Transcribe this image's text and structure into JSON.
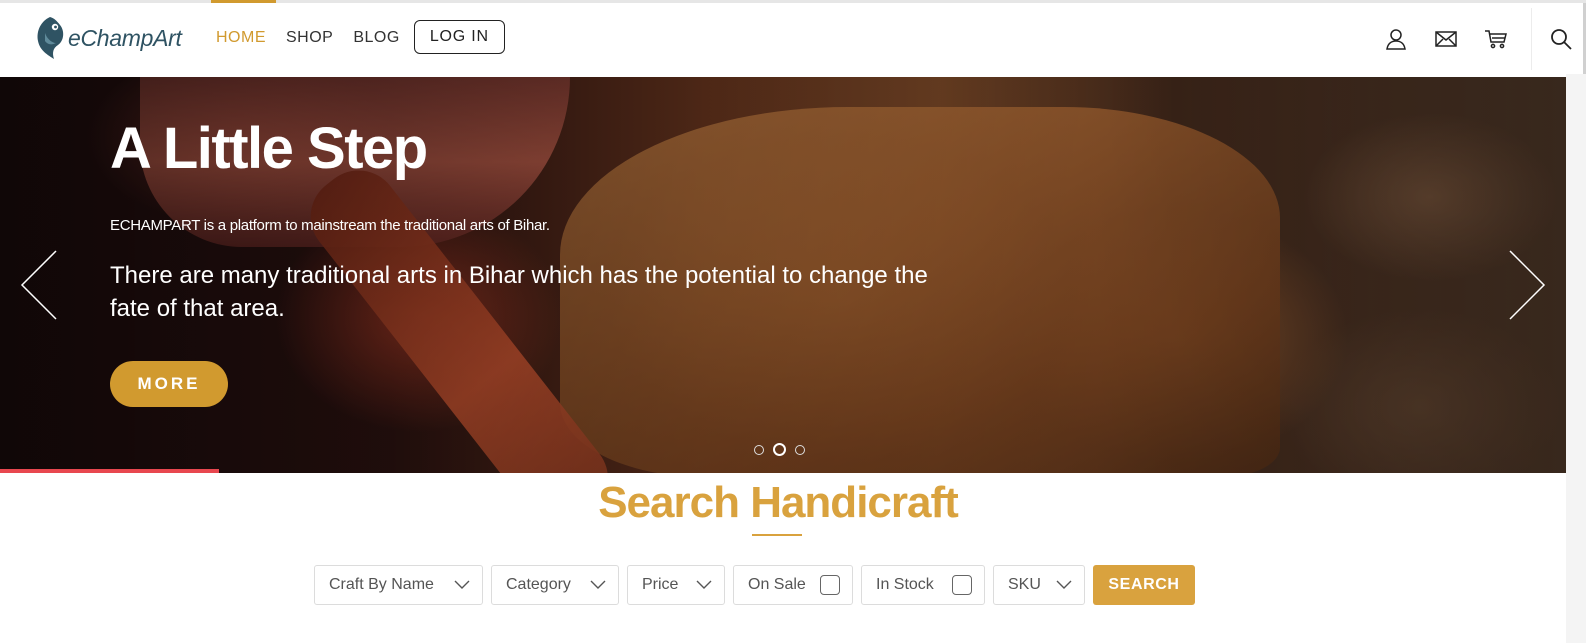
{
  "brand": {
    "name": "eChampArt"
  },
  "nav": {
    "items": [
      {
        "label": "HOME",
        "active": true
      },
      {
        "label": "SHOP",
        "active": false
      },
      {
        "label": "BLOG",
        "active": false
      }
    ],
    "login_label": "LOG IN"
  },
  "header_icons": [
    "user-icon",
    "mail-icon",
    "cart-icon",
    "search-icon"
  ],
  "hero": {
    "title": "A Little Step",
    "subtitle": "ECHAMPART is a platform to mainstream the traditional arts of Bihar.",
    "description": "There are many traditional arts in Bihar which has the potential to change the fate of that area.",
    "button_label": "MORE",
    "slides_count": 3,
    "active_slide": 2,
    "slide_progress_fraction": 0.14
  },
  "search": {
    "title": "Search Handicraft",
    "filters": {
      "craft": "Craft By Name",
      "category": "Category",
      "price": "Price",
      "on_sale": "On Sale",
      "in_stock": "In Stock",
      "sku": "SKU"
    },
    "button_label": "SEARCH"
  },
  "colors": {
    "accent": "#d19a2f",
    "title_gold": "#d9a23e",
    "progress_red": "#e8474f",
    "logo_blue": "#2f5363"
  }
}
